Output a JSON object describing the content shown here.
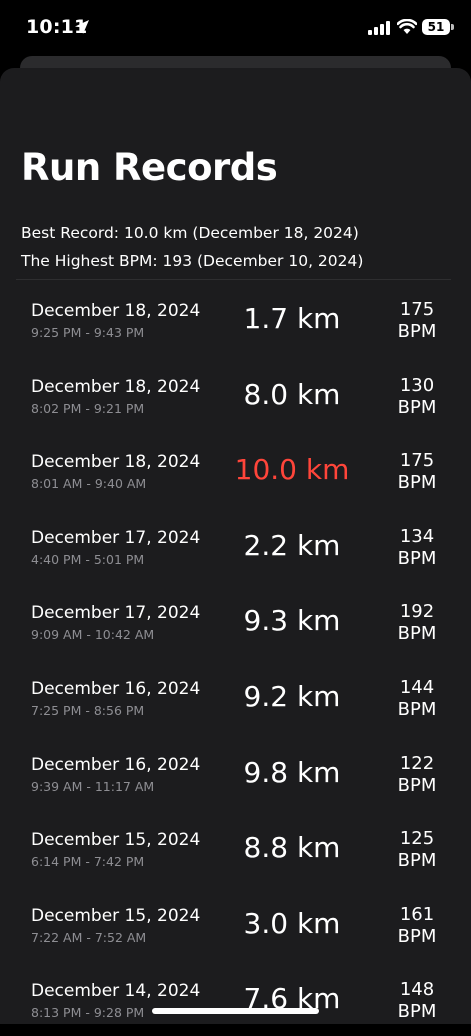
{
  "status_bar": {
    "time": "10:11",
    "battery": "51"
  },
  "title": "Run Records",
  "summary": {
    "best_record": "Best Record: 10.0 km (December 18, 2024)",
    "highest_bpm": "The Highest BPM: 193 (December 10, 2024)"
  },
  "colors": {
    "background": "#1c1c1e",
    "best_distance": "#ff453a",
    "secondary_text": "#8e8e93"
  },
  "records": [
    {
      "date": "December 18, 2024",
      "time": "9:25 PM - 9:43 PM",
      "distance": "1.7 km",
      "bpm": "175",
      "bpm_unit": "BPM",
      "best": false
    },
    {
      "date": "December 18, 2024",
      "time": "8:02 PM - 9:21 PM",
      "distance": "8.0 km",
      "bpm": "130",
      "bpm_unit": "BPM",
      "best": false
    },
    {
      "date": "December 18, 2024",
      "time": "8:01 AM - 9:40 AM",
      "distance": "10.0 km",
      "bpm": "175",
      "bpm_unit": "BPM",
      "best": true
    },
    {
      "date": "December 17, 2024",
      "time": "4:40 PM - 5:01 PM",
      "distance": "2.2 km",
      "bpm": "134",
      "bpm_unit": "BPM",
      "best": false
    },
    {
      "date": "December 17, 2024",
      "time": "9:09 AM - 10:42 AM",
      "distance": "9.3 km",
      "bpm": "192",
      "bpm_unit": "BPM",
      "best": false
    },
    {
      "date": "December 16, 2024",
      "time": "7:25 PM - 8:56 PM",
      "distance": "9.2 km",
      "bpm": "144",
      "bpm_unit": "BPM",
      "best": false
    },
    {
      "date": "December 16, 2024",
      "time": "9:39 AM - 11:17 AM",
      "distance": "9.8 km",
      "bpm": "122",
      "bpm_unit": "BPM",
      "best": false
    },
    {
      "date": "December 15, 2024",
      "time": "6:14 PM - 7:42 PM",
      "distance": "8.8 km",
      "bpm": "125",
      "bpm_unit": "BPM",
      "best": false
    },
    {
      "date": "December 15, 2024",
      "time": "7:22 AM - 7:52 AM",
      "distance": "3.0 km",
      "bpm": "161",
      "bpm_unit": "BPM",
      "best": false
    },
    {
      "date": "December 14, 2024",
      "time": "8:13 PM - 9:28 PM",
      "distance": "7.6 km",
      "bpm": "148",
      "bpm_unit": "BPM",
      "best": false
    }
  ]
}
